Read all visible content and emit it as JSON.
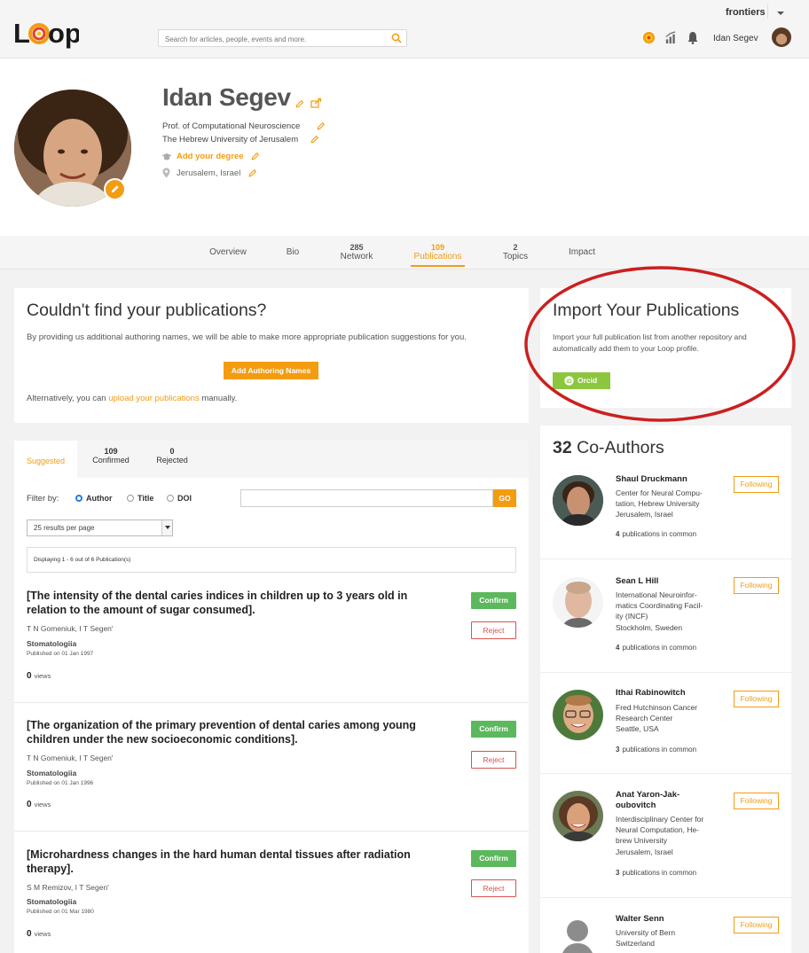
{
  "header": {
    "logo": "Loop",
    "search_placeholder": "Search for articles, people, events and more.",
    "brand": "frontiers",
    "user_name": "Idan Segev"
  },
  "profile": {
    "name": "Idan Segev",
    "position": "Prof. of Computational Neuroscience",
    "institution": "The Hebrew University of Jerusalem",
    "add_degree": "Add your degree",
    "location": "Jerusalem, Israel"
  },
  "tabs": [
    {
      "count": "",
      "label": "Overview"
    },
    {
      "count": "",
      "label": "Bio"
    },
    {
      "count": "285",
      "label": "Network"
    },
    {
      "count": "109",
      "label": "Publications"
    },
    {
      "count": "2",
      "label": "Topics"
    },
    {
      "count": "",
      "label": "Impact"
    }
  ],
  "find_card": {
    "title": "Couldn't find your publications?",
    "text": "By providing us additional authoring names, we will be able to make more appropriate publication suggestions for you.",
    "button": "Add Authoring Names",
    "alt_prefix": "Alternatively, you can ",
    "alt_link": "upload your publications",
    "alt_suffix": " manually."
  },
  "import_card": {
    "title": "Import Your Publications",
    "text": "Import your full publication list from another repository and automatically add them to your Loop profile.",
    "button": "Orcid",
    "highlight_color": "#cc1f1f"
  },
  "pub_tabs": [
    {
      "count": "",
      "label": "Suggested"
    },
    {
      "count": "109",
      "label": "Confirmed"
    },
    {
      "count": "0",
      "label": "Rejected"
    }
  ],
  "filter": {
    "label": "Filter by:",
    "options": [
      "Author",
      "Title",
      "DOI"
    ],
    "selected": "Author",
    "go": "GO",
    "per_page": "25 results per page",
    "displaying": "Displaying 1 - 6 out of 6 Publication(s)"
  },
  "publications": [
    {
      "title": "[The intensity of the dental caries indices in children up to 3 years old in relation to the amount of sugar consumed].",
      "authors": "T N Gomeniuk, I T Segen'",
      "journal": "Stomatologiia",
      "date": "Published on 01 Jan 1997",
      "views": "0",
      "views_label": "views",
      "confirm": "Confirm",
      "reject": "Reject"
    },
    {
      "title": "[The organization of the primary prevention of dental caries among young children under the new socioeconomic conditions].",
      "authors": "T N Gomeniuk, I T Segen'",
      "journal": "Stomatologiia",
      "date": "Published on 01 Jan 1996",
      "views": "0",
      "views_label": "views",
      "confirm": "Confirm",
      "reject": "Reject"
    },
    {
      "title": "[Microhardness changes in the hard human dental tissues after radiation therapy].",
      "authors": "S M Remizov, I T Segen'",
      "journal": "Stomatologiia",
      "date": "Published on 01 Mar 1980",
      "views": "0",
      "views_label": "views",
      "confirm": "Confirm",
      "reject": "Reject"
    }
  ],
  "coauthors": {
    "count": "32",
    "label": "Co-Authors",
    "follow_label": "Following",
    "pubs_suffix": "publications in common",
    "items": [
      {
        "name": "Shaul Druckmann",
        "aff": [
          "Center for Neural Compu-",
          "tation, Hebrew University",
          "Jerusalem, Israel"
        ],
        "pubs": "4"
      },
      {
        "name": "Sean L Hill",
        "aff": [
          "International Neuroinfor-",
          "matics Coordinating Facil-",
          "ity (INCF)",
          "Stockholm, Sweden"
        ],
        "pubs": "4"
      },
      {
        "name": "Ithai Rabinowitch",
        "aff": [
          "Fred Hutchinson Cancer",
          "Research Center",
          "Seattle, USA"
        ],
        "pubs": "3"
      },
      {
        "name": "Anat Yaron-Jak-\noubovitch",
        "aff": [
          "Interdisciplinary Center for",
          "Neural Computation, He-",
          "brew University",
          "Jerusalem, Israel"
        ],
        "pubs": "3"
      },
      {
        "name": "Walter Senn",
        "aff": [
          "University of Bern",
          "Switzerland"
        ],
        "pubs": ""
      }
    ]
  },
  "colors": {
    "accent": "#f39c12",
    "confirm": "#5cb85c",
    "reject": "#d9534f",
    "orcid": "#8cc63f"
  }
}
